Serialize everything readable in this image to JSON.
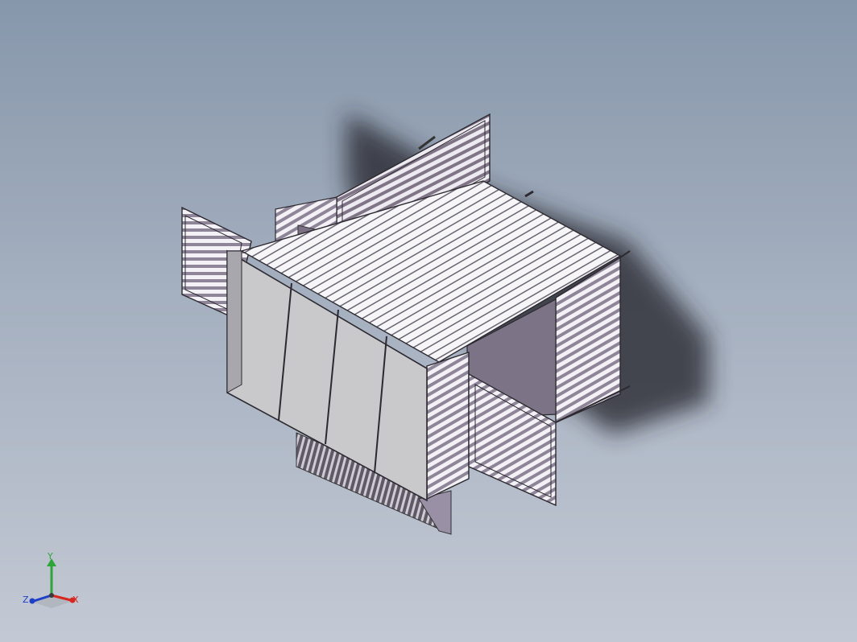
{
  "viewport": {
    "background_top": "#8797ab",
    "background_bottom": "#c3c9d4",
    "model": "container-shelter-isometric"
  },
  "triad": {
    "x_label": "X",
    "y_label": "Y",
    "z_label": "Z",
    "x_color": "#d8271f",
    "y_color": "#2fa43a",
    "z_color": "#1e3fc8"
  }
}
